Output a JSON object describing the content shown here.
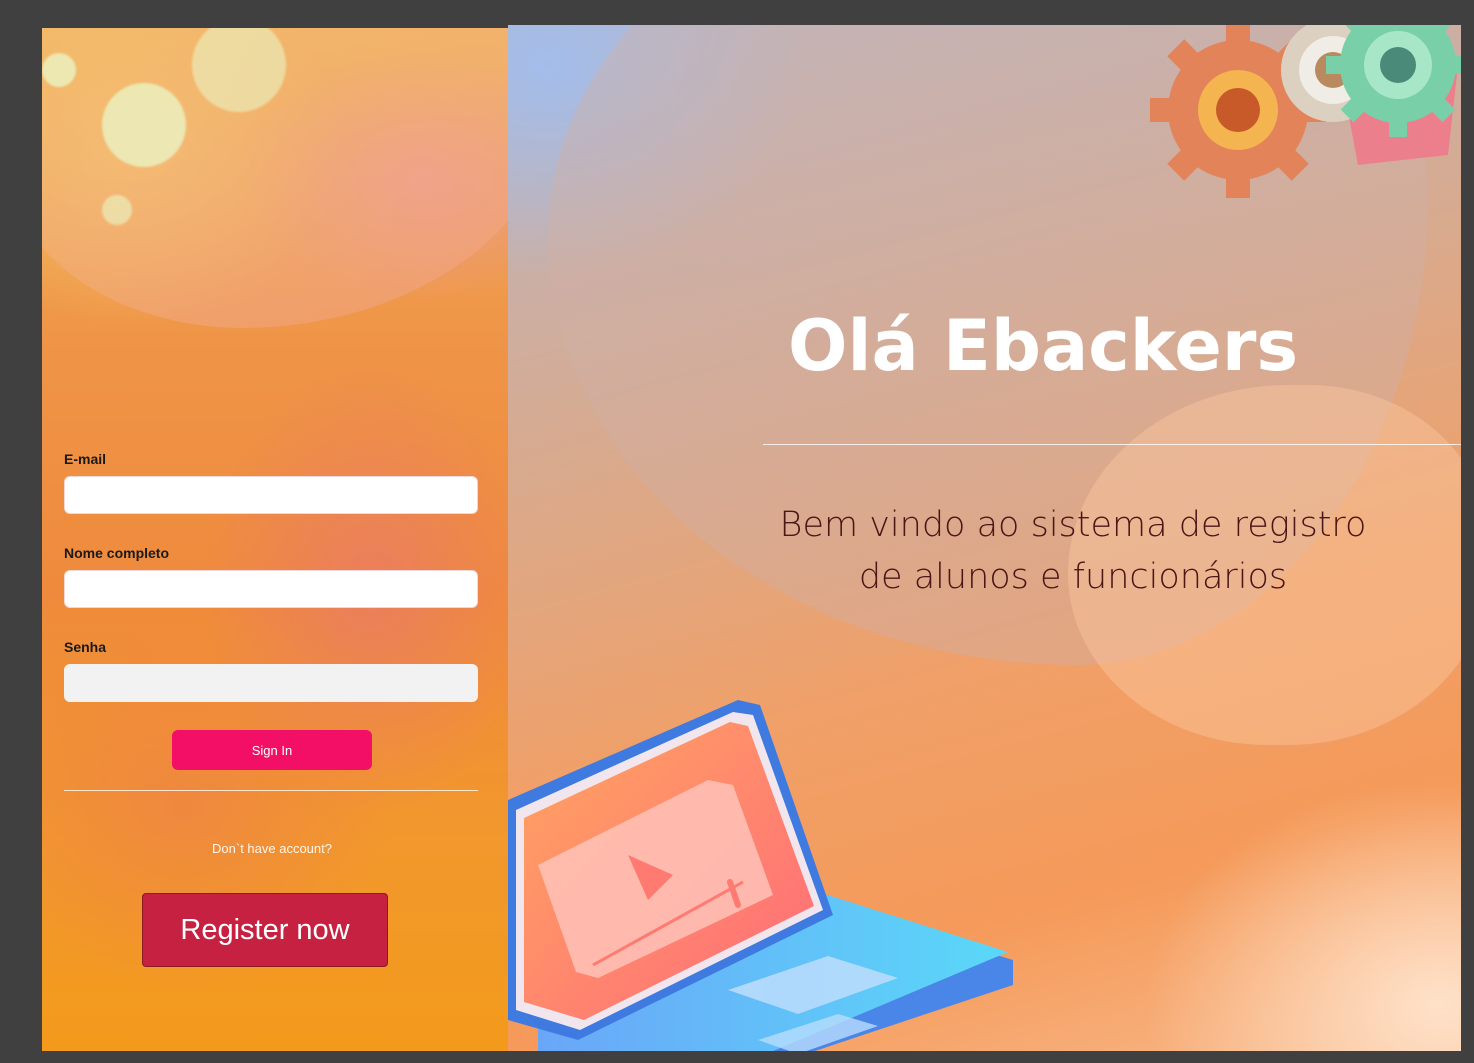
{
  "login": {
    "email_label": "E-mail",
    "email_value": "",
    "name_label": "Nome completo",
    "name_value": "",
    "password_label": "Senha",
    "password_value": "",
    "signin_label": "Sign In",
    "no_account_text": "Don`t have account?",
    "register_label": "Register now"
  },
  "welcome": {
    "title": "Olá Ebackers",
    "subtitle": "Bem vindo ao sistema de registro de alunos e funcionários"
  },
  "colors": {
    "signin_button": "#f20f65",
    "register_button": "#c62141",
    "title_text": "#ffffff",
    "subtitle_text": "#4a1616"
  },
  "icons": [
    "gears-illustration-icon",
    "laptop-illustration-icon",
    "play-icon"
  ]
}
